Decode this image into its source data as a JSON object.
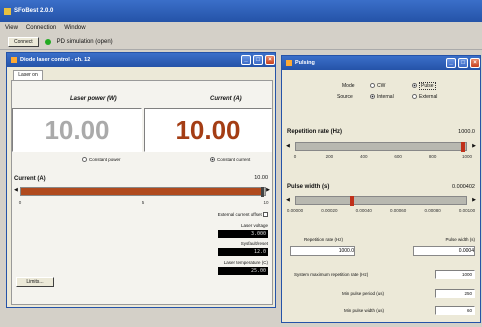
{
  "app": {
    "title": "SFoBest 2.0.0"
  },
  "menu": [
    "View",
    "Connection",
    "Window"
  ],
  "toolbar": {
    "connect": "Connect",
    "status": "PD simulation (open)"
  },
  "laser_window": {
    "title": "Diode laser control - ch. 12",
    "tab": "Laser on",
    "power_label": "Laser power (W)",
    "current_label": "Current (A)",
    "power_value": "10.00",
    "current_value": "10.00",
    "mode_constant_power": "Constant power",
    "mode_constant_current": "Constant current",
    "current_slider_label": "Current (A)",
    "current_slider_value": "10.00",
    "current_fraction": 0.99,
    "current_ticks": [
      "0",
      "5",
      "10"
    ],
    "external_offset": "External current offset",
    "laser_voltage_label": "Laser voltage",
    "laser_voltage": "3.000",
    "sysfault_label": "Sysfault/reset",
    "sysfault": "12.0",
    "laser_temp_label": "Laser temperature (C)",
    "laser_temp": "25.00",
    "bottom_btn": "Limits..."
  },
  "pulsing_window": {
    "title": "Pulsing",
    "mode_label": "Mode",
    "mode_cw": "CW",
    "mode_pulse": "Pulse",
    "source_label": "Source",
    "source_internal": "Internal",
    "source_external": "External",
    "rep_label": "Repetition rate (Hz)",
    "rep_value": "1000.0",
    "rep_fraction": 0.98,
    "rep_ticks": [
      "0",
      "200",
      "400",
      "600",
      "800",
      "1000"
    ],
    "width_label": "Pulse width (s)",
    "width_value": "0.000402",
    "width_fraction": 0.33,
    "width_ticks": [
      "0.00000",
      "0.00020",
      "0.00040",
      "0.00060",
      "0.00080",
      "0.00100"
    ],
    "rep_field_label": "Repetition rate (Hz)",
    "width_field_label": "Pulse width (s)",
    "rep_field": "1000.0",
    "width_field": "0.0004",
    "sys_max_label": "System maximum repetition rate (Hz)",
    "sys_max": "1000",
    "min_period_label": "Min pulse period (us)",
    "min_period": "250",
    "min_width_label": "Min pulse width (us)",
    "min_width": "60"
  }
}
